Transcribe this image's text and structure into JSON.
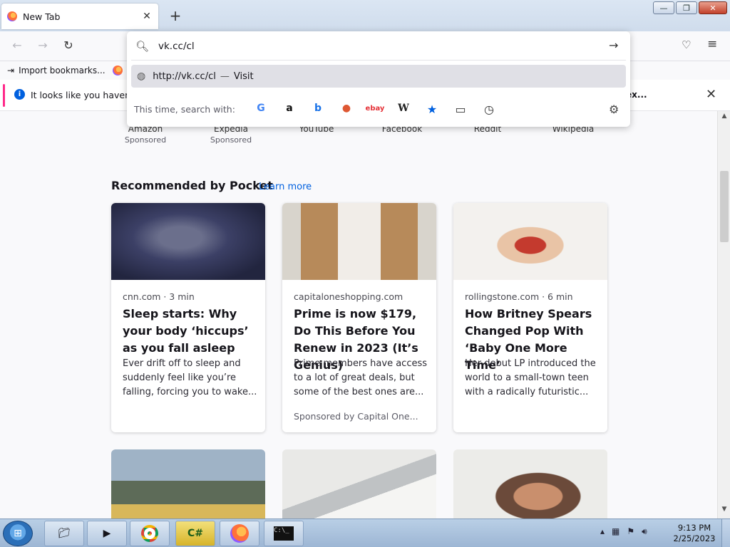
{
  "window": {
    "tab_title": "New Tab",
    "new_tab_symbol": "+",
    "minimize": "—",
    "maximize": "❐",
    "close": "✕"
  },
  "nav": {
    "back": "←",
    "forward": "→",
    "reload": "↻",
    "pocket": "♡",
    "menu": "≡"
  },
  "bookmarks": {
    "import_label": "Import bookmarks...",
    "second_label": "G"
  },
  "notice": {
    "message": "It looks like you haven’t s",
    "right_text": "ex...",
    "info_symbol": "i",
    "close_symbol": "✕"
  },
  "urlbar": {
    "value": "vk.cc/cl",
    "go_symbol": "→",
    "suggestion_url": "http://vk.cc/cl",
    "suggestion_sep": "—",
    "suggestion_action": "Visit",
    "search_with_label": "This time, search with:",
    "engines": [
      {
        "name": "google",
        "glyph": "G",
        "color": "#4285f4"
      },
      {
        "name": "amazon",
        "glyph": "a",
        "color": "#111111"
      },
      {
        "name": "bing",
        "glyph": "b",
        "color": "#1a73e8"
      },
      {
        "name": "duckduckgo",
        "glyph": "●",
        "color": "#de5833"
      },
      {
        "name": "ebay",
        "glyph": "ebay",
        "color": "#e53238"
      },
      {
        "name": "wikipedia",
        "glyph": "W",
        "color": "#222222"
      },
      {
        "name": "bookmarks",
        "glyph": "★",
        "color": "#0060df"
      },
      {
        "name": "tabs",
        "glyph": "▭",
        "color": "#333333"
      },
      {
        "name": "history",
        "glyph": "◷",
        "color": "#333333"
      }
    ],
    "gear_symbol": "⚙"
  },
  "topsites": [
    {
      "name": "Amazon",
      "sponsored": "Sponsored"
    },
    {
      "name": "Expedia",
      "sponsored": "Sponsored"
    },
    {
      "name": "YouTube",
      "sponsored": ""
    },
    {
      "name": "Facebook",
      "sponsored": ""
    },
    {
      "name": "Reddit",
      "sponsored": ""
    },
    {
      "name": "Wikipedia",
      "sponsored": ""
    }
  ],
  "pocket": {
    "title": "Recommended by Pocket",
    "learn_more": "Learn more",
    "cards": [
      {
        "source": "cnn.com · 3 min",
        "headline": "Sleep starts: Why your body ‘hiccups’ as you fall asleep",
        "excerpt": "Ever drift off to sleep and suddenly feel like you’re falling, forcing you to wake...",
        "sponsor": ""
      },
      {
        "source": "capitaloneshopping.com",
        "headline": "Prime is now $179, Do This Before You Renew in 2023 (It’s Genius)",
        "excerpt": "Prime members have access to a lot of great deals, but some of the best ones are...",
        "sponsor": "Sponsored by Capital One..."
      },
      {
        "source": "rollingstone.com · 6 min",
        "headline": "How Britney Spears Changed Pop With ‘Baby One More Time’",
        "excerpt": "Her debut LP introduced the world to a small-town teen with a radically futuristic...",
        "sponsor": ""
      }
    ]
  },
  "taskbar": {
    "time": "9:13 PM",
    "date": "2/25/2023",
    "apps": [
      "explorer",
      "media-player",
      "chrome",
      "csharp",
      "firefox",
      "cmd"
    ]
  }
}
